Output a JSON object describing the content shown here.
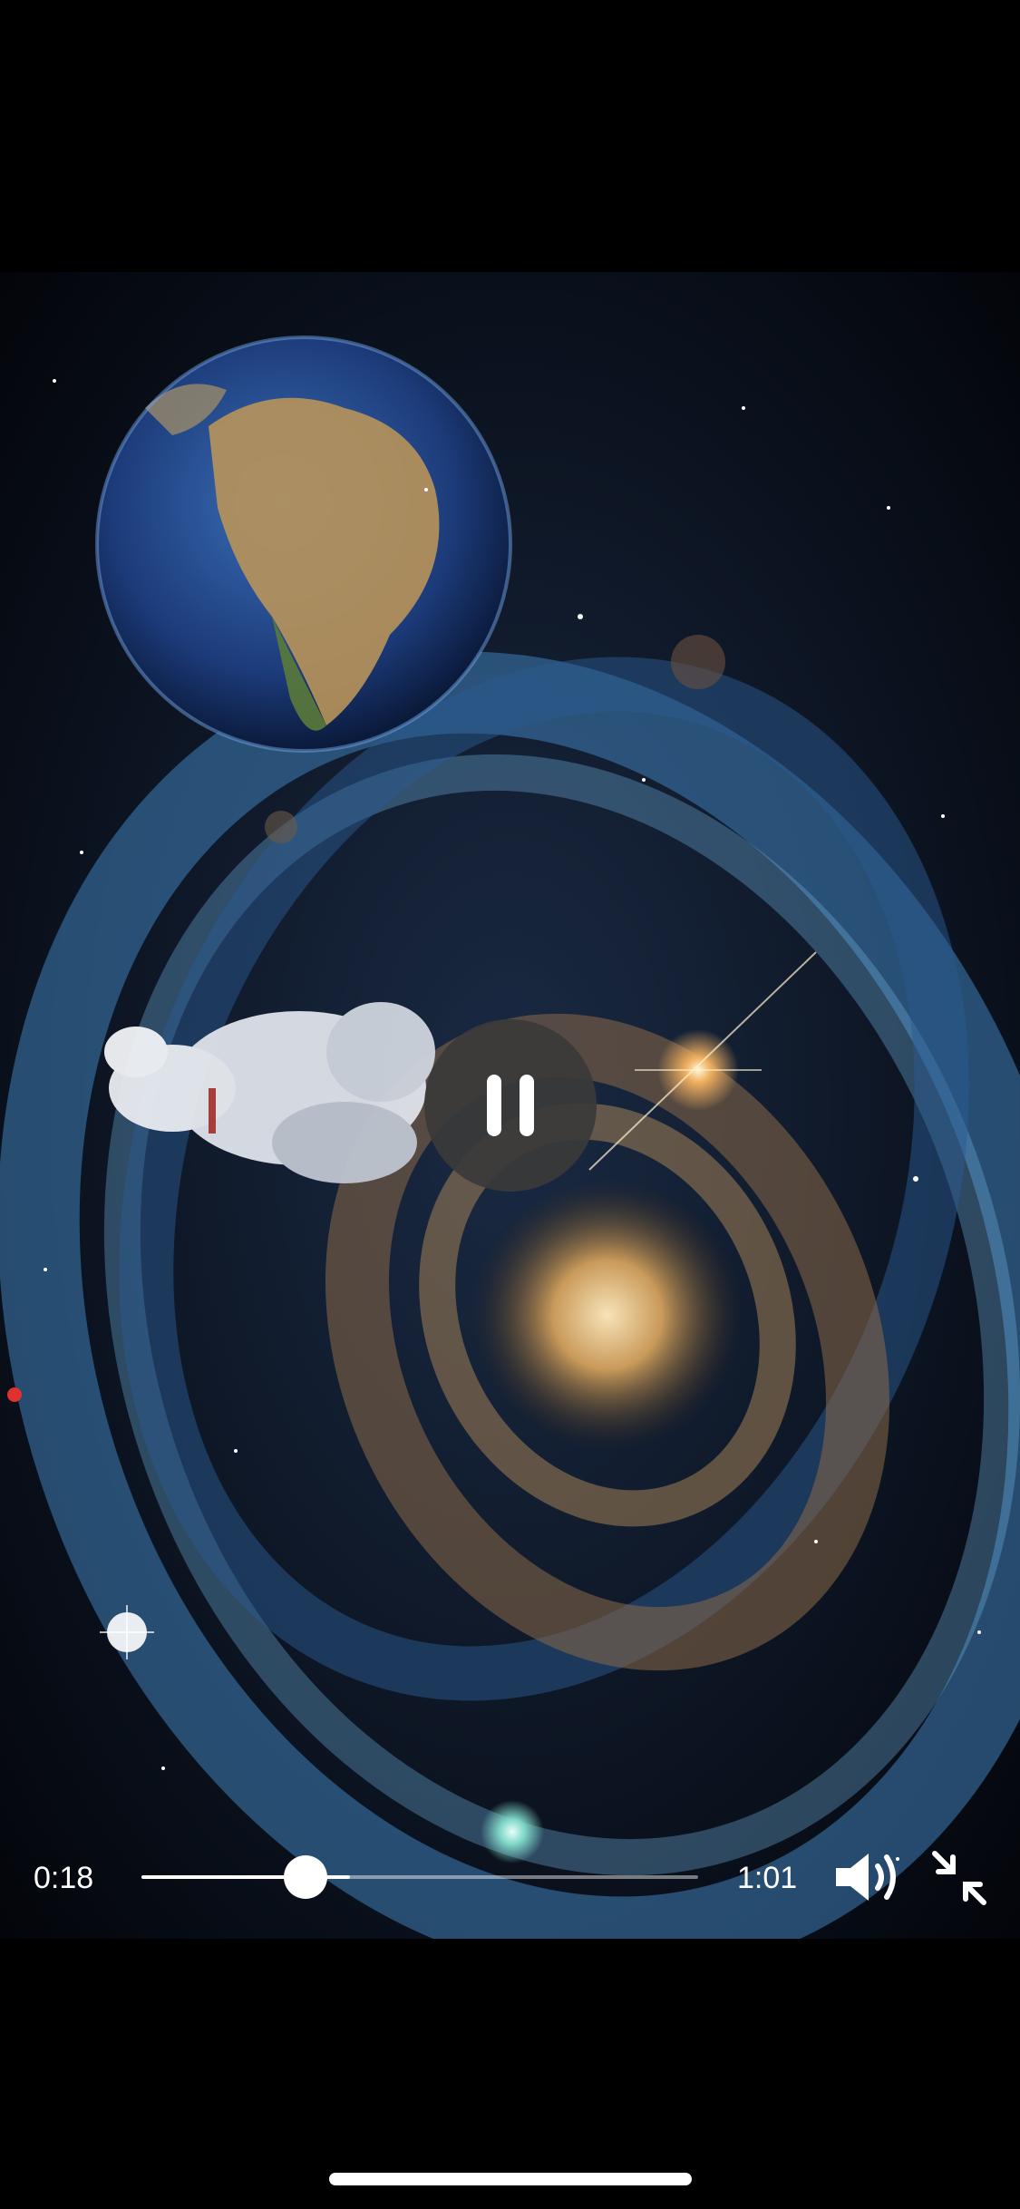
{
  "player": {
    "current_time": "0:18",
    "total_time": "1:01",
    "progress": 0.295,
    "buffered": 0.375,
    "state": "playing"
  },
  "icons": {
    "center": "pause-icon",
    "volume": "speaker-volume-icon",
    "collapse": "exit-fullscreen-icon"
  },
  "colors": {
    "background": "#000000",
    "control_text": "#ffffff",
    "pause_button_bg": "#3a3a3a"
  }
}
